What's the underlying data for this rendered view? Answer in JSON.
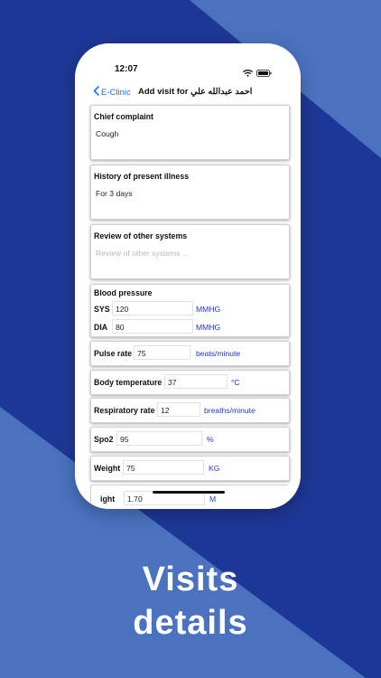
{
  "status_bar": {
    "time": "12:07"
  },
  "nav": {
    "back_label": "E-Clinic",
    "title": "Add visit for احمد عبدالله علي"
  },
  "chief_complaint": {
    "label": "Chief complaint",
    "value": "Cough"
  },
  "history": {
    "label": "History of present illness",
    "value": "For 3 days"
  },
  "review": {
    "label": "Review of other systems",
    "placeholder": "Review of other systems ..."
  },
  "blood_pressure": {
    "label": "Blood pressure",
    "sys_label": "SYS",
    "sys_value": "120",
    "sys_unit": "MMHG",
    "dia_label": "DIA",
    "dia_value": "80",
    "dia_unit": "MMHG"
  },
  "pulse": {
    "label": "Pulse rate",
    "value": "75",
    "unit": "beats/minute"
  },
  "temperature": {
    "label": "Body temperature",
    "value": "37",
    "unit": "°C"
  },
  "respiratory": {
    "label": "Respiratory rate",
    "value": "12",
    "unit": "breaths/minute"
  },
  "spo2": {
    "label": "Spo2",
    "value": "95",
    "unit": "%"
  },
  "weight": {
    "label": "Weight",
    "value": "75",
    "unit": "KG"
  },
  "height_partial": {
    "label": "ight",
    "value": "1.70",
    "unit": "M"
  },
  "caption": {
    "line1": "Visits",
    "line2": "details"
  },
  "colors": {
    "bg_dark": "#1d3796",
    "bg_light": "#4a72bf",
    "link_blue": "#1d6ff0",
    "unit_blue": "#2436c9"
  }
}
